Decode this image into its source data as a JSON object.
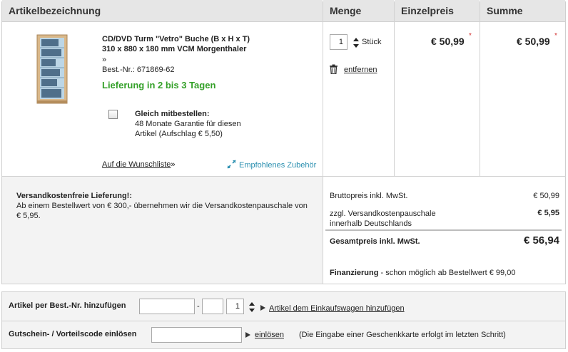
{
  "columns": {
    "article": "Artikelbezeichnung",
    "quantity": "Menge",
    "unit_price": "Einzelpreis",
    "total": "Summe"
  },
  "product": {
    "title_line1": "CD/DVD Turm \"Vetro\" Buche (B x H x T)",
    "title_line2": "310 x 880 x 180 mm VCM Morgenthaler",
    "title_line3": "»",
    "order_no": "Best.-Nr.: 671869-62",
    "delivery": "Lieferung in 2 bis 3 Tagen",
    "quantity_value": "1",
    "quantity_unit": "Stück",
    "remove_label": "entfernen",
    "unit_price": "€ 50,99",
    "total_price": "€ 50,99",
    "price_marker": "*",
    "addon_title": "Gleich mitbestellen:",
    "addon_line1": "48 Monate Garantie für diesen",
    "addon_line2": "Artikel (Aufschlag € 5,50)",
    "wishlist_label": "Auf die Wunschliste",
    "wishlist_arrow": "»",
    "accessories_label": "Empfohlenes Zubehör"
  },
  "shipping": {
    "title": "Versandkostenfreie Lieferung!:",
    "text_line1": "Ab einem Bestellwert von € 300,- übernehmen wir die Versandkostenpauschale von",
    "text_line2": "€ 5,95."
  },
  "summary": {
    "gross_label": "Bruttopreis inkl. MwSt.",
    "gross_value": "€ 50,99",
    "shipping_label_line1": "zzgl. Versandkostenpauschale",
    "shipping_label_line2": "innerhalb Deutschlands",
    "shipping_value": "€ 5,95",
    "total_label": "Gesamtpreis inkl. MwSt.",
    "total_value": "€ 56,94",
    "financing_label": "Finanzierung",
    "financing_text": " - schon möglich ab Bestellwert € 99,00"
  },
  "add_by_number": {
    "label": "Artikel per Best.-Nr. hinzufügen",
    "separator": "-",
    "qty_value": "1",
    "link_label": "Artikel dem Einkaufswagen hinzufügen"
  },
  "voucher": {
    "label": "Gutschein- / Vorteilscode einlösen",
    "link_label": "einlösen",
    "note": "(Die Eingabe einer Geschenkkarte erfolgt im letzten Schritt)"
  },
  "colors": {
    "delivery_green": "#33a028",
    "accent_teal": "#2a8fb0",
    "marker_red": "#d22b2b"
  }
}
